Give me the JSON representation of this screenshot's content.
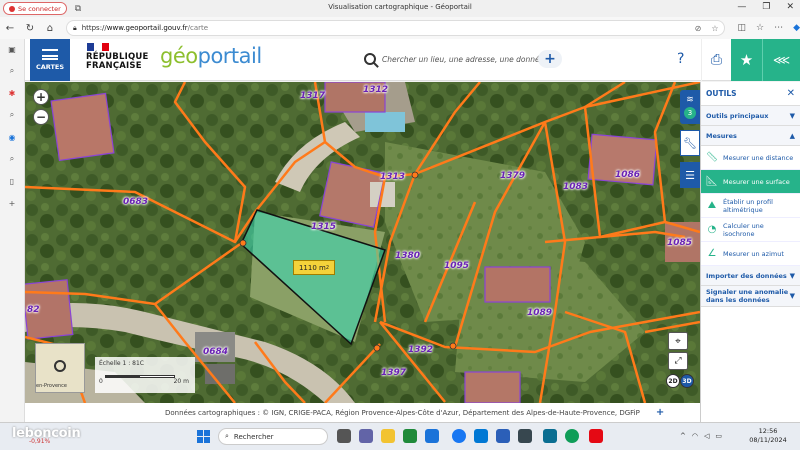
{
  "browser": {
    "signin_label": "Se connecter",
    "window_title": "Visualisation cartographique - Géoportail",
    "url_prefix": "https://",
    "url_host": "www.geoportail.gouv.fr",
    "url_path": "/carte"
  },
  "header": {
    "menu_label": "CARTES",
    "republic_line1": "RÉPUBLIQUE",
    "republic_line2": "FRANÇAISE",
    "logo_geo": "géo",
    "logo_portail": "portail",
    "search_placeholder": "Chercher un lieu, une adresse, une donnée",
    "help_label": "?"
  },
  "map": {
    "parcel_labels": [
      {
        "id": "p1317",
        "text": "1317"
      },
      {
        "id": "p1312",
        "text": "1312"
      },
      {
        "id": "p1313",
        "text": "1313"
      },
      {
        "id": "p1379",
        "text": "1379"
      },
      {
        "id": "p1083",
        "text": "1083"
      },
      {
        "id": "p1086",
        "text": "1086"
      },
      {
        "id": "p0683",
        "text": "0683"
      },
      {
        "id": "p1315",
        "text": "1315"
      },
      {
        "id": "p1380",
        "text": "1380"
      },
      {
        "id": "p1095",
        "text": "1095"
      },
      {
        "id": "p1085",
        "text": "1085"
      },
      {
        "id": "p1089",
        "text": "1089"
      },
      {
        "id": "p82",
        "text": "82"
      },
      {
        "id": "p0684",
        "text": "0684"
      },
      {
        "id": "p1392",
        "text": "1392"
      },
      {
        "id": "p1397",
        "text": "1397"
      }
    ],
    "layers_count": "3",
    "area_value": "1110 m",
    "area_exp": "2",
    "minimap_label": "en-Provence",
    "scale_text": "Échelle 1 : 81C",
    "scale_min": "0",
    "scale_max": "20 m",
    "view_2d": "2D",
    "view_3d": "3D"
  },
  "attribution": {
    "text": "Données cartographiques : ©    IGN,  CRIGE-PACA,  Région Provence-Alpes-Côte d'Azur,  Département des Alpes-de-Haute-Provence,  DGFiP"
  },
  "tools_panel": {
    "title": "OUTILS",
    "sections": {
      "main": "Outils principaux",
      "measures": "Mesures",
      "import": "Importer des données",
      "report": "Signaler une anomalie dans les données"
    },
    "tools": {
      "distance": "Mesurer une distance",
      "surface": "Mesurer une surface",
      "profile": "Établir un profil altimétrique",
      "isochrone": "Calculer une isochrone",
      "azimuth": "Mesurer un azimut"
    }
  },
  "taskbar": {
    "brand": "leboncoin",
    "ticker": "-0,91%",
    "search_label": "Rechercher",
    "time": "12:56",
    "date": "08/11/2024"
  },
  "colors": {
    "brand_blue": "#1e5aa8",
    "accent_green": "#26b38a",
    "parcel_orange": "#ff7a1a",
    "label_purple": "#6a22b5"
  }
}
